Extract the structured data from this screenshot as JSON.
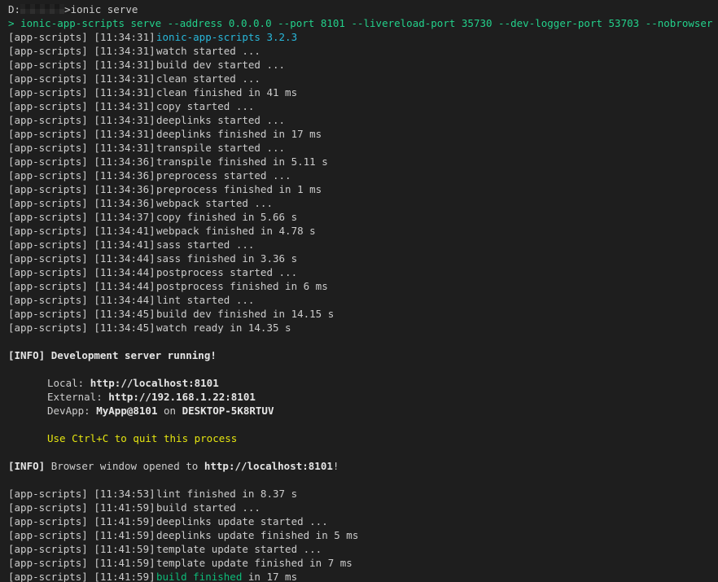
{
  "window": {
    "prompt_drive": "D:",
    "prompt_command": "ionic serve",
    "echo_prefix": "> ",
    "echo_command": "ionic-app-scripts serve --address 0.0.0.0 --port 8101 --livereload-port 35730 --dev-logger-port 53703 --nobrowser"
  },
  "log_prefix": "[app-scripts]",
  "build_log": [
    {
      "time": "[11:34:31]",
      "msg": "ionic-app-scripts 3.2.3"
    },
    {
      "time": "[11:34:31]",
      "msg": "watch started ..."
    },
    {
      "time": "[11:34:31]",
      "msg": "build dev started ..."
    },
    {
      "time": "[11:34:31]",
      "msg": "clean started ..."
    },
    {
      "time": "[11:34:31]",
      "msg": "clean finished in 41 ms"
    },
    {
      "time": "[11:34:31]",
      "msg": "copy started ..."
    },
    {
      "time": "[11:34:31]",
      "msg": "deeplinks started ..."
    },
    {
      "time": "[11:34:31]",
      "msg": "deeplinks finished in 17 ms"
    },
    {
      "time": "[11:34:31]",
      "msg": "transpile started ..."
    },
    {
      "time": "[11:34:36]",
      "msg": "transpile finished in 5.11 s"
    },
    {
      "time": "[11:34:36]",
      "msg": "preprocess started ..."
    },
    {
      "time": "[11:34:36]",
      "msg": "preprocess finished in 1 ms"
    },
    {
      "time": "[11:34:36]",
      "msg": "webpack started ..."
    },
    {
      "time": "[11:34:37]",
      "msg": "copy finished in 5.66 s"
    },
    {
      "time": "[11:34:41]",
      "msg": "webpack finished in 4.78 s"
    },
    {
      "time": "[11:34:41]",
      "msg": "sass started ..."
    },
    {
      "time": "[11:34:44]",
      "msg": "sass finished in 3.36 s"
    },
    {
      "time": "[11:34:44]",
      "msg": "postprocess started ..."
    },
    {
      "time": "[11:34:44]",
      "msg": "postprocess finished in 6 ms"
    },
    {
      "time": "[11:34:44]",
      "msg": "lint started ..."
    },
    {
      "time": "[11:34:45]",
      "msg": "build dev finished in 14.15 s"
    },
    {
      "time": "[11:34:45]",
      "msg": "watch ready in 14.35 s"
    }
  ],
  "info": {
    "tag": "[INFO]",
    "server_running": "Development server running!",
    "local_label": "Local: ",
    "local_url": "http://localhost:8101",
    "external_label": "External: ",
    "external_url": "http://192.168.1.22:8101",
    "devapp_label": "DevApp: ",
    "devapp_name": "MyApp@8101",
    "devapp_on": " on ",
    "devapp_host": "DESKTOP-5K8RTUV",
    "quit_hint": "Use Ctrl+C to quit this process",
    "browser_opened": "Browser window opened to ",
    "browser_url": "http://localhost:8101",
    "browser_suffix": "!"
  },
  "update_log": [
    {
      "time": "[11:34:53]",
      "msg": "lint finished in 8.37 s"
    },
    {
      "time": "[11:41:59]",
      "msg": "build started ..."
    },
    {
      "time": "[11:41:59]",
      "msg": "deeplinks update started ..."
    },
    {
      "time": "[11:41:59]",
      "msg": "deeplinks update finished in 5 ms"
    },
    {
      "time": "[11:41:59]",
      "msg": "template update started ..."
    },
    {
      "time": "[11:41:59]",
      "msg": "template update finished in 7 ms"
    }
  ],
  "last_line": {
    "time": "[11:41:59]",
    "highlight": "build finished",
    "rest": " in 17 ms"
  },
  "colors": {
    "background": "#1e1e1e",
    "text": "#cccccc",
    "green": "#23d18b",
    "cyan": "#29b8db",
    "yellow": "#e5e510"
  }
}
